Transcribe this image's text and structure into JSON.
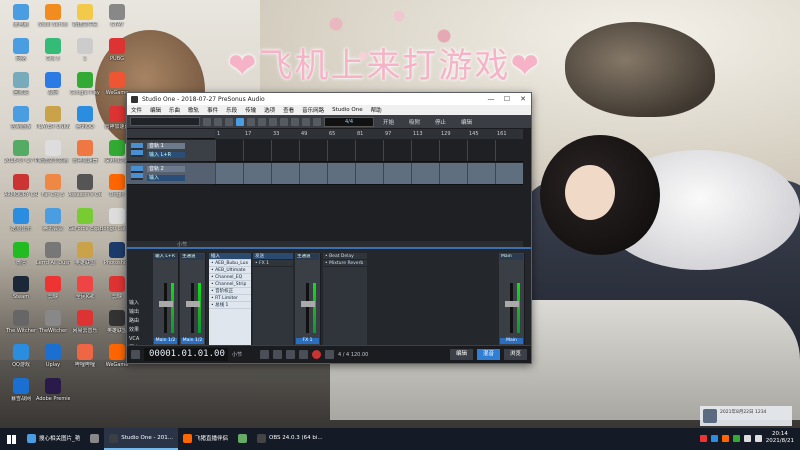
{
  "overlay_title": "❤飞机上来打游戏❤",
  "desktop_icons": [
    {
      "label": "此电脑",
      "color": "#4a9de0"
    },
    {
      "label": "Steel\nSeries",
      "color": "#f28c1e"
    },
    {
      "label": "新建文件夹",
      "color": "#f3c94a"
    },
    {
      "label": "GTAV",
      "color": "#888"
    },
    {
      "label": "网络",
      "color": "#4a9de0"
    },
    {
      "label": "Gta 5",
      "color": "#3b7"
    },
    {
      "label": "1",
      "color": "#ccc"
    },
    {
      "label": "PUBG",
      "color": "#d33"
    },
    {
      "label": "回收站",
      "color": "#7ab"
    },
    {
      "label": "战网",
      "color": "#2c7be5"
    },
    {
      "label": "Google Play",
      "color": "#3a3"
    },
    {
      "label": "WeGame",
      "color": "#e53"
    },
    {
      "label": "控制面板",
      "color": "#4a9de0"
    },
    {
      "label": "PLAYER UNKNOWN'S BATTLEGR",
      "color": "#c9a24a"
    },
    {
      "label": "腾讯QQ",
      "color": "#2a8de0"
    },
    {
      "label": "雷神加速器",
      "color": "#d33"
    },
    {
      "label": "2018-07-27 PreSonus...",
      "color": "#5a6"
    },
    {
      "label": "新建文本文档",
      "color": "#ddd"
    },
    {
      "label": "雷神加速器",
      "color": "#e74"
    },
    {
      "label": "深港城之战",
      "color": "#3a3"
    },
    {
      "label": "ARMOURY CRATE",
      "color": "#c33"
    },
    {
      "label": "Far Cry 5",
      "color": "#e84"
    },
    {
      "label": "Assassin's Creed",
      "color": "#555"
    },
    {
      "label": "Origin",
      "color": "#f60"
    },
    {
      "label": "酷狗音乐",
      "color": "#2a8de0"
    },
    {
      "label": "腾讯会议",
      "color": "#4a9de0"
    },
    {
      "label": "GeForce Experience",
      "color": "#7c3"
    },
    {
      "label": "Bongo Cat Mver",
      "color": "#ddd"
    },
    {
      "label": "微信",
      "color": "#2b2"
    },
    {
      "label": "Lerrd All Dusm",
      "color": "#777"
    },
    {
      "label": "英雄联盟",
      "color": "#c9a24a"
    },
    {
      "label": "Photoshop",
      "color": "#1c3b6a"
    },
    {
      "label": "Steam",
      "color": "#1b2838"
    },
    {
      "label": "剪映",
      "color": "#e33"
    },
    {
      "label": "全民K歌",
      "color": "#e44"
    },
    {
      "label": "剪映",
      "color": "#d33"
    },
    {
      "label": "The Witcher",
      "color": "#666"
    },
    {
      "label": "TheWitcher",
      "color": "#888"
    },
    {
      "label": "网易云音乐",
      "color": "#d33"
    },
    {
      "label": "英雄联盟",
      "color": "#333"
    },
    {
      "label": "QQ游戏",
      "color": "#2a8de0"
    },
    {
      "label": "Uplay",
      "color": "#1a6fd0"
    },
    {
      "label": "哔哩哔哩",
      "color": "#e64"
    },
    {
      "label": "WeGame",
      "color": "#f60"
    },
    {
      "label": "暴雪战网",
      "color": "#1a6fd0"
    },
    {
      "label": "Adobe Premie",
      "color": "#2a1a4a"
    }
  ],
  "window": {
    "title": "Studio One - 2018-07-27 PreSonus Audio",
    "controls": [
      "—",
      "☐",
      "✕"
    ],
    "menu": [
      "文件",
      "编辑",
      "乐曲",
      "歌轨",
      "事件",
      "乐段",
      "传输",
      "选项",
      "查看",
      "音乐网路",
      "Studio One",
      "帮助"
    ],
    "toolbar": {
      "display": "4/4",
      "label_timing": "开始",
      "label_snap": "吸附",
      "label_stop": "停止",
      "label_right": "编辑"
    },
    "ruler": [
      "1",
      "17",
      "33",
      "49",
      "65",
      "81",
      "97",
      "113",
      "129",
      "145",
      "161"
    ],
    "tracks": [
      {
        "name": "音轨 1",
        "input": "输入 L+R",
        "selected": false
      },
      {
        "name": "音轨 2",
        "input": "输入",
        "selected": true
      }
    ],
    "arrange_footer": "小节",
    "mixer": {
      "strips": [
        {
          "header": "输入 L+R",
          "footer": "Main 1/2"
        },
        {
          "header": "主通道",
          "footer": "Main 1/2"
        },
        {
          "header": "输入 L+R",
          "footer": "Main 1/2"
        },
        {
          "header": "主通道",
          "footer": "Main 1/2"
        }
      ],
      "side_buttons": [
        "输入",
        "输出",
        "路由",
        "效果",
        "VCA",
        "历史"
      ],
      "inserts_header": "插入",
      "inserts": [
        "AEB_Bubu_Lux",
        "AEB_Ultimate",
        "Channel_EQ",
        "Channel_Strip",
        "音阶校正",
        "RT Limiter",
        "总线 1"
      ],
      "sends_header": "发送",
      "sends": [
        "FX 1"
      ],
      "fx": [
        "Beat Delay",
        "Mixture Reverb"
      ],
      "fx_footer": "FX 1",
      "main_header": "Main",
      "main_footer": "Main"
    },
    "transport": {
      "time": "00001.01.01.00",
      "sub_time": "小节",
      "info": "4 / 4   120.00",
      "tabs": [
        "编辑",
        "混音",
        "浏览"
      ],
      "active_tab": "混音"
    }
  },
  "taskbar": {
    "tasks": [
      {
        "label": "搜心相关图片_艳",
        "color": "#4a9de0",
        "active": false
      },
      {
        "label": "",
        "color": "#888",
        "active": false
      },
      {
        "label": "Studio One - 201...",
        "color": "#3a3f46",
        "active": true
      },
      {
        "label": "飞猪直播伴侣",
        "color": "#f60",
        "active": false
      },
      {
        "label": "",
        "color": "#6a6",
        "active": false
      },
      {
        "label": "OBS 24.0.3 (64 bi...",
        "color": "#444",
        "active": false
      }
    ],
    "tray_icons": [
      "#e33",
      "#2a8de0",
      "#f60",
      "#3a3",
      "#ddd",
      "#ddd"
    ],
    "time": "20:14",
    "date": "2021/8/21"
  },
  "notification": "2021年8月22日  1234"
}
